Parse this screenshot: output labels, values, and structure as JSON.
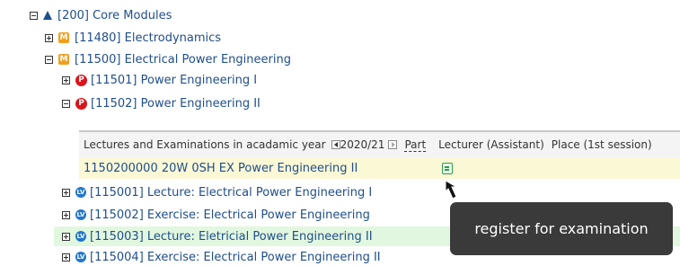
{
  "tree": {
    "core": {
      "label": "[200] Core Modules"
    },
    "electrodynamics": {
      "label": "[11480] Electrodynamics",
      "badge": "M"
    },
    "epe": {
      "label": "[11500] Electrical Power Engineering",
      "badge": "M"
    },
    "pe1": {
      "label": "[11501] Power Engineering I",
      "badge": "P"
    },
    "pe2": {
      "label": "[11502] Power Engineering II",
      "badge": "P"
    }
  },
  "table": {
    "header": {
      "title": "Lectures and Examinations in acadamic year",
      "year": "2020/21",
      "part": "Part",
      "lecturer": "Lecturer (Assistant)",
      "place": "Place (1st session)"
    },
    "exam": {
      "text": "1150200000 20W 0SH EX Power Engineering II"
    }
  },
  "courses": [
    {
      "label": "[115001] Lecture: Electrical Power Engineering I",
      "badge": "LV"
    },
    {
      "label": "[115002] Exercise: Electrical Power Engineering",
      "badge": "LV"
    },
    {
      "label": "[115003] Lecture: Eletricial Power Engineering II",
      "badge": "LV"
    },
    {
      "label": "[115004] Exercise: Electrical Power Engineering II",
      "badge": "LV"
    }
  ],
  "tooltip": {
    "text": "register for examination"
  },
  "colors": {
    "link": "#1f4e8c",
    "exam_bg": "#fbf8d6",
    "highlight_bg": "#e2f7df",
    "tooltip_bg": "#3a3a3a"
  }
}
